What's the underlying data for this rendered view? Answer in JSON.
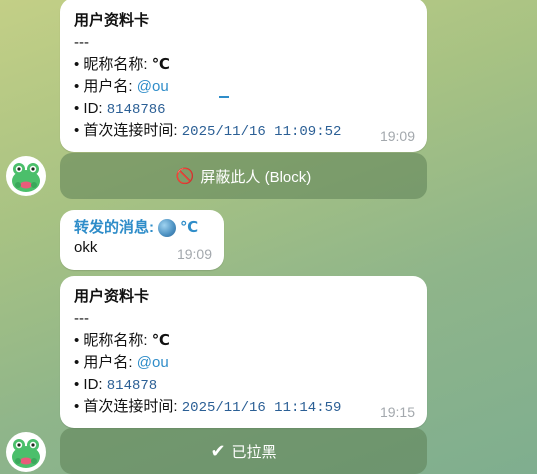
{
  "card1": {
    "title": "用户资料卡",
    "sep": "---",
    "nickname_label": "• 昵称名称: ",
    "nickname_value": "℃",
    "username_label": "• 用户名: ",
    "username_value": "@ou",
    "id_label": "• ID: ",
    "id_value": "8148786",
    "first_label": "• 首次连接时间: ",
    "first_value": "2025/11/16 11:09:52",
    "time": "19:09"
  },
  "block_button": {
    "icon": "🚫",
    "label": "屏蔽此人 (Block)"
  },
  "forward": {
    "prefix": "转发的消息:",
    "name": "℃",
    "text": "okk",
    "time": "19:09"
  },
  "card2": {
    "title": "用户资料卡",
    "sep": "---",
    "nickname_label": "• 昵称名称: ",
    "nickname_value": "℃",
    "username_label": "• 用户名: ",
    "username_value": "@ou",
    "id_label": "• ID: ",
    "id_value": "814878",
    "first_label": "• 首次连接时间: ",
    "first_value": "2025/11/16 11:14:59",
    "time": "19:15"
  },
  "blocked_button": {
    "icon": "✔",
    "label": "已拉黑"
  },
  "colors": {
    "link": "#2f8dc9",
    "mono": "#2b5f95",
    "keyboard_button": "#6a8c63"
  }
}
